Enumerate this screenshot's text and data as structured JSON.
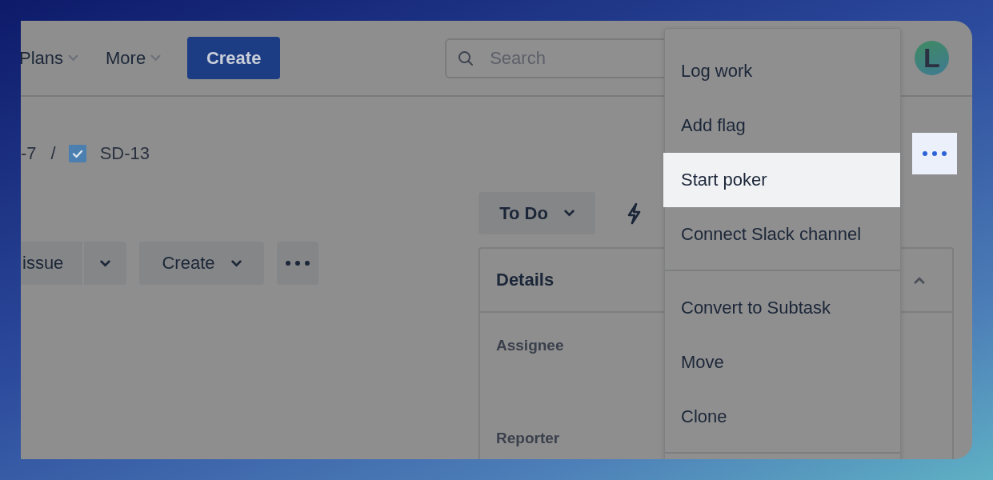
{
  "header": {
    "nav": [
      {
        "label": "Plans"
      },
      {
        "label": "More"
      }
    ],
    "create_button": "Create",
    "search": {
      "placeholder": "Search"
    },
    "avatar": "L"
  },
  "breadcrumbs": {
    "parent": "-7",
    "separator": "/",
    "issue": {
      "key": "SD-13",
      "checked": true
    }
  },
  "more_button": {
    "selected": true
  },
  "actions": {
    "split_button": "issue",
    "create": "Create"
  },
  "status": {
    "label": "To Do"
  },
  "details": {
    "title": "Details",
    "expanded": true,
    "fields": [
      {
        "label": "Assignee"
      },
      {
        "label": "Reporter"
      }
    ]
  },
  "menu": {
    "groups": [
      [
        {
          "label": "Log work",
          "selected": false
        },
        {
          "label": "Add flag",
          "selected": false
        },
        {
          "label": "Start poker",
          "selected": true
        },
        {
          "label": "Connect Slack channel",
          "selected": false
        }
      ],
      [
        {
          "label": "Convert to Subtask",
          "selected": false
        },
        {
          "label": "Move",
          "selected": false
        },
        {
          "label": "Clone",
          "selected": false
        }
      ]
    ]
  }
}
